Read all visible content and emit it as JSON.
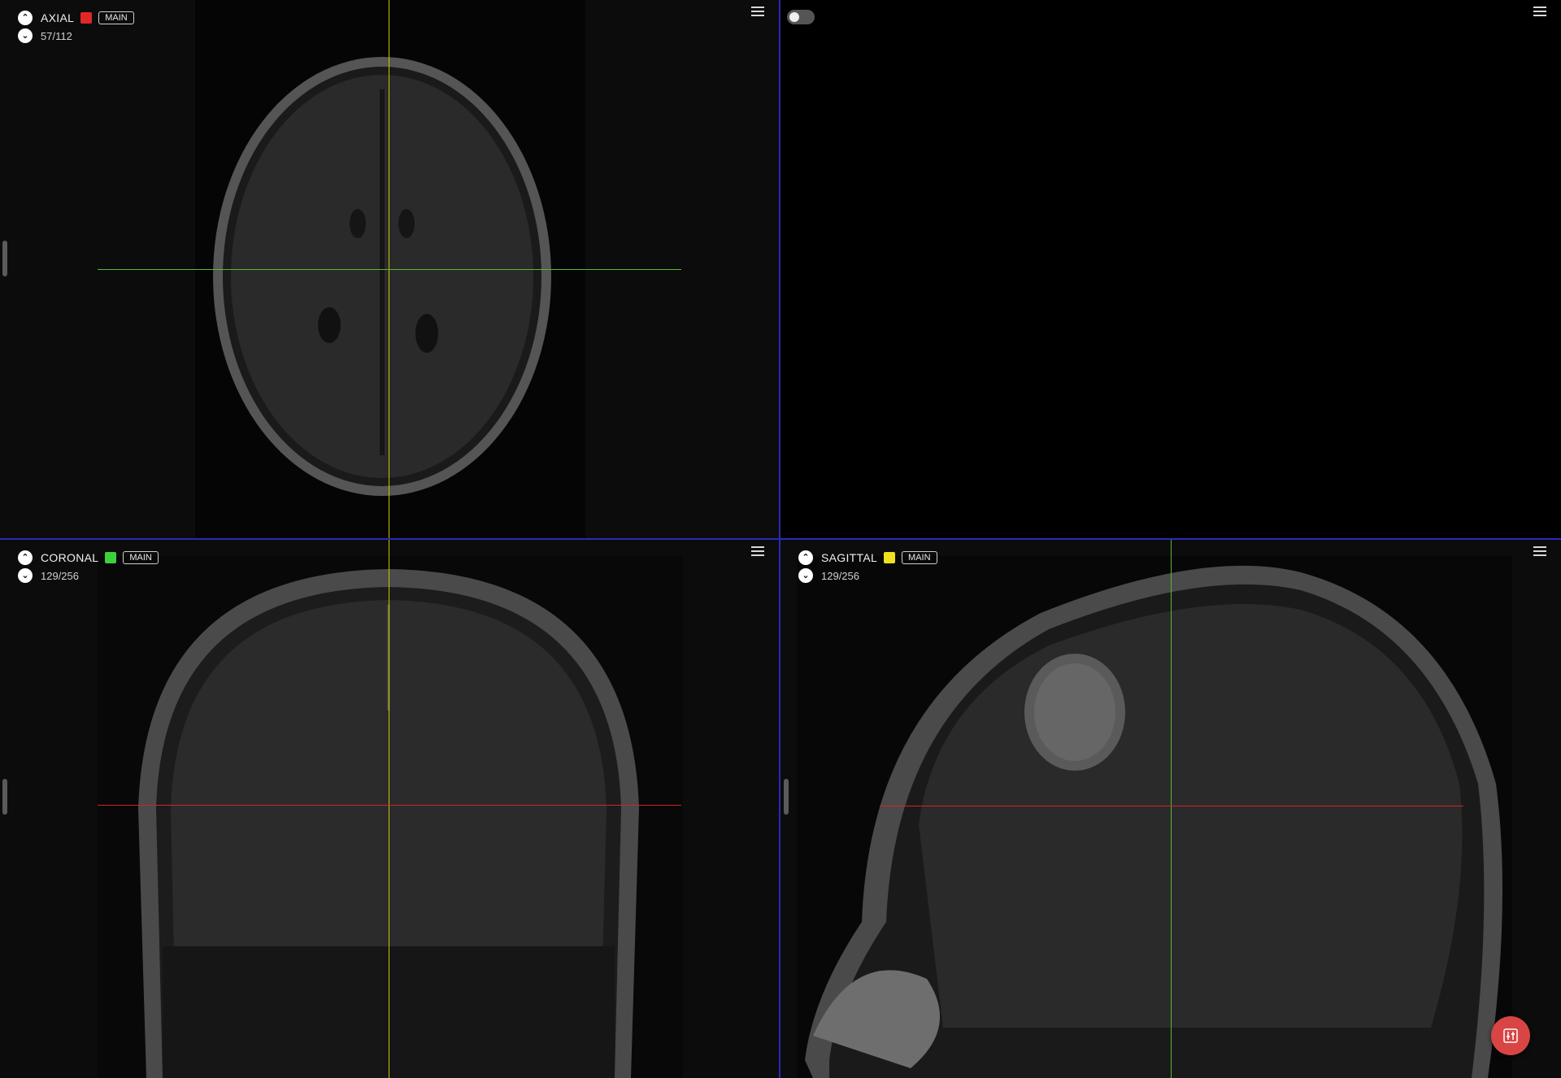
{
  "viewports": {
    "axial": {
      "name": "AXIAL",
      "tag": "MAIN",
      "slice": "57/112",
      "color": "#e02828"
    },
    "coronal": {
      "name": "CORONAL",
      "tag": "MAIN",
      "slice": "129/256",
      "color": "#3cd13c"
    },
    "sagittal": {
      "name": "SAGITTAL",
      "tag": "MAIN",
      "slice": "129/256",
      "color": "#f0e020"
    }
  },
  "icons": {
    "prev_slice": "chevron-up-icon",
    "next_slice": "chevron-down-icon",
    "menu": "hamburger-menu-icon",
    "fab": "sliders-icon"
  },
  "crosshair_colors": {
    "axial_line": "#d0d000",
    "coronal_line": "#5ab835",
    "sagittal_line": "#d02525"
  },
  "three_d": {
    "toggle_on": false
  },
  "accent": {
    "divider": "#2a2ab8",
    "fab": "#d94545"
  }
}
